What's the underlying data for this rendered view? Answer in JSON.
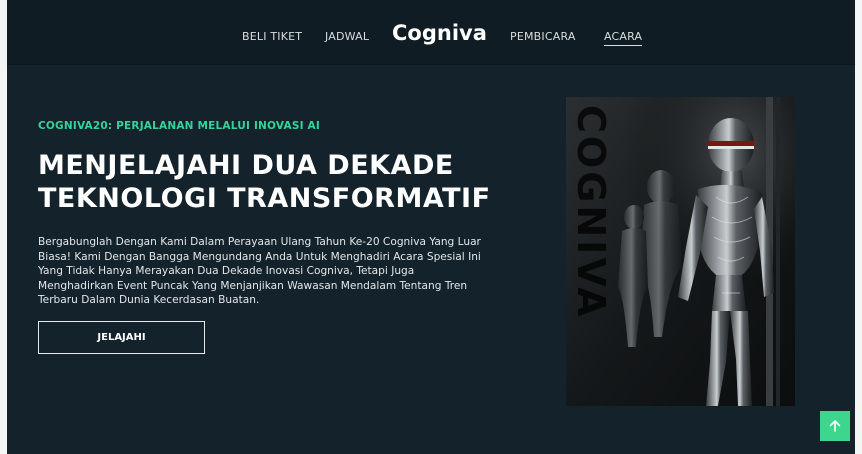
{
  "nav": {
    "items": [
      "BELI TIKET",
      "JADWAL",
      "PEMBICARA",
      "ACARA"
    ],
    "brand": "Cogniva",
    "active": "ACARA"
  },
  "hero": {
    "eyebrow": "COGNIVA20: PERJALANAN MELALUI INOVASI AI",
    "title_line1": "MENJELAJAHI DUA DEKADE",
    "title_line2": "TEKNOLOGI TRANSFORMATIF",
    "body": "Bergabunglah Dengan Kami Dalam Perayaan Ulang Tahun Ke-20 Cogniva Yang Luar Biasa! Kami Dengan Bangga Mengundang Anda Untuk Menghadiri Acara Spesial Ini Yang Tidak Hanya Merayakan Dua Dekade Inovasi Cogniva, Tetapi Juga Menghadirkan Event Puncak Yang Menjanjikan Wawasan Mendalam Tentang Tren Terbaru Dalam Dunia Kecerdasan Buatan.",
    "cta_label": "JELAJAHI",
    "image_watermark": "COGNIVA"
  },
  "colors": {
    "background": "#13222b",
    "accent": "#35d39a",
    "scroll_button": "#3ed68f"
  },
  "icons": {
    "scroll_top": "arrow-up-icon",
    "hero_image": "robot-image"
  }
}
